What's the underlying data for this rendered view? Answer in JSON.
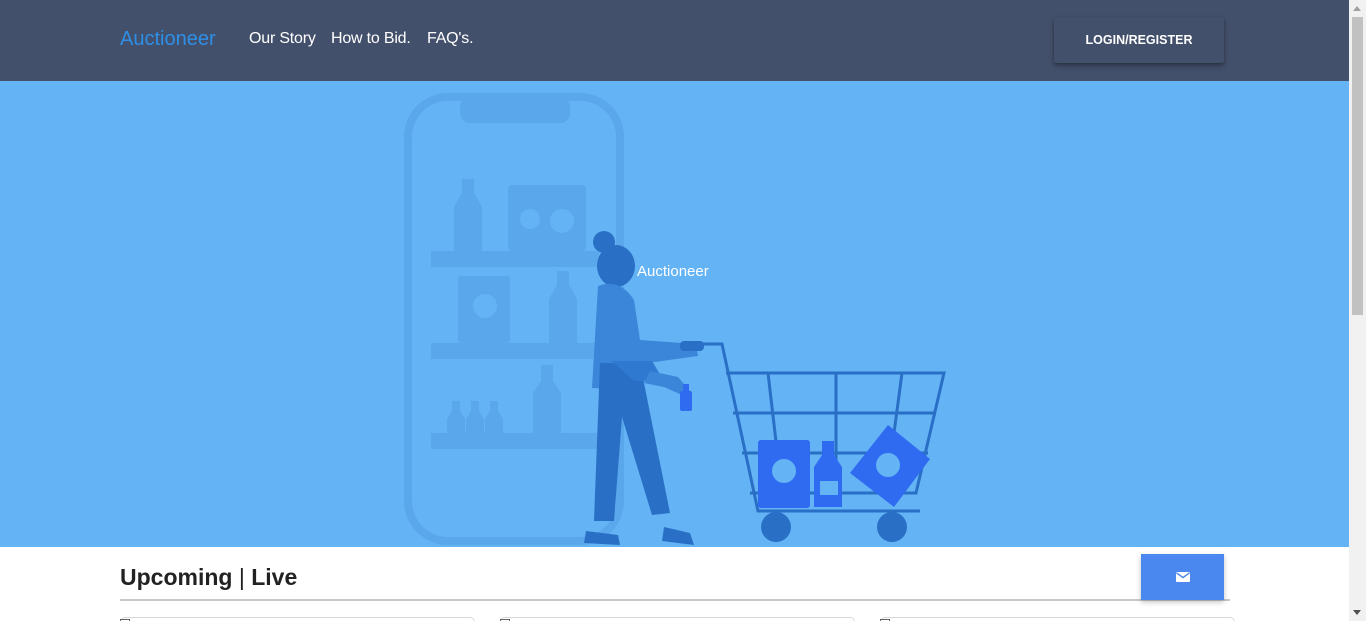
{
  "header": {
    "brand": "Auctioneer",
    "nav": [
      "Our Story",
      "How to Bid.",
      "FAQ's."
    ],
    "login_label": "LOGIN/REGISTER"
  },
  "hero": {
    "caption": "Auctioneer",
    "background_color": "#63b3f5"
  },
  "section": {
    "title_left": "Upcoming",
    "separator": "|",
    "title_right": "Live"
  },
  "colors": {
    "navbar": "#43506b",
    "brand": "#2e8fe6",
    "mail_button": "#4a87ee"
  },
  "icons": {
    "mail_button": "envelope-icon"
  }
}
